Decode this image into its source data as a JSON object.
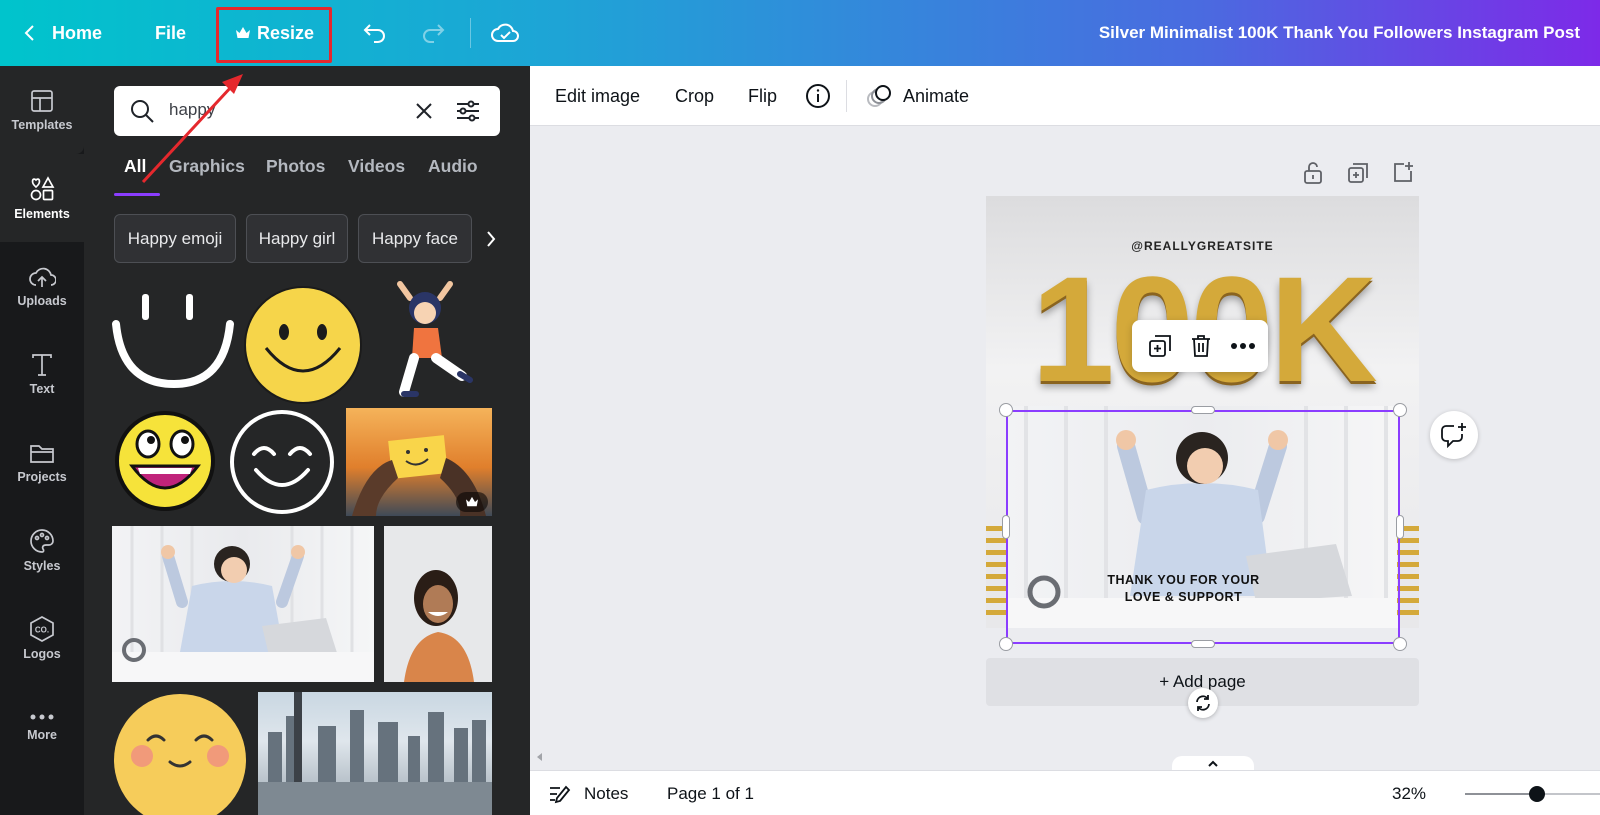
{
  "topbar": {
    "home_label": "Home",
    "file_label": "File",
    "resize_label": "Resize",
    "doc_title": "Silver Minimalist 100K Thank You Followers Instagram Post"
  },
  "sidebar": {
    "items": [
      {
        "label": "Templates",
        "icon": "templates-icon"
      },
      {
        "label": "Elements",
        "icon": "elements-icon"
      },
      {
        "label": "Uploads",
        "icon": "upload-icon"
      },
      {
        "label": "Text",
        "icon": "text-icon"
      },
      {
        "label": "Projects",
        "icon": "folder-icon"
      },
      {
        "label": "Styles",
        "icon": "palette-icon"
      },
      {
        "label": "Logos",
        "icon": "logo-icon"
      },
      {
        "label": "More",
        "icon": "more-icon"
      }
    ]
  },
  "panel": {
    "search_value": "happy",
    "tabs": [
      "All",
      "Graphics",
      "Photos",
      "Videos",
      "Audio"
    ],
    "chips": [
      "Happy emoji",
      "Happy girl",
      "Happy face"
    ]
  },
  "context_toolbar": {
    "edit_image": "Edit image",
    "crop": "Crop",
    "flip": "Flip",
    "animate": "Animate"
  },
  "canvas": {
    "handle_text": "@REALLYGREATSITE",
    "big_text": "100K",
    "caption_line1": "THANK YOU FOR YOUR",
    "caption_line2": "LOVE & SUPPORT",
    "add_page": "+ Add page"
  },
  "bottombar": {
    "notes": "Notes",
    "page_indicator": "Page 1 of 1",
    "zoom": "32%"
  },
  "colors": {
    "accent": "#8b3dff",
    "annotation_red": "#e5282d",
    "gold": "#d4a93a",
    "smiley_yellow": "#f6d54a"
  }
}
